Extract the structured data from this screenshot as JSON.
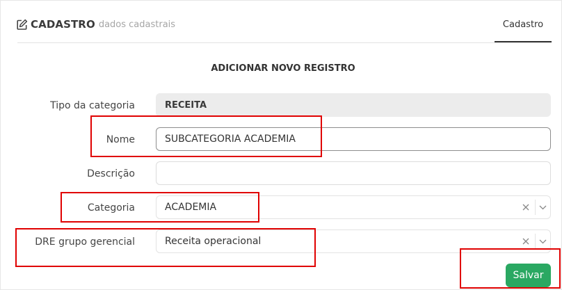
{
  "header": {
    "title": "CADASTRO",
    "subtitle": "dados cadastrais",
    "edit_icon": "edit-icon",
    "tab_label": "Cadastro"
  },
  "form": {
    "heading": "ADICIONAR NOVO REGISTRO",
    "tipo_categoria": {
      "label": "Tipo da categoria",
      "value": "RECEITA"
    },
    "nome": {
      "label": "Nome",
      "value": "SUBCATEGORIA ACADEMIA"
    },
    "descricao": {
      "label": "Descrição",
      "value": ""
    },
    "categoria": {
      "label": "Categoria",
      "value": "ACADEMIA",
      "clear_icon": "clear-x-icon",
      "dropdown_icon": "chevron-down-icon"
    },
    "dre_grupo": {
      "label": "DRE grupo gerencial",
      "value": "Receita operacional",
      "clear_icon": "clear-x-icon",
      "dropdown_icon": "chevron-down-icon"
    },
    "save_label": "Salvar"
  },
  "colors": {
    "save_button": "#2aa862",
    "highlight_boxes": "#e00000",
    "readonly_field": "#ececec"
  }
}
